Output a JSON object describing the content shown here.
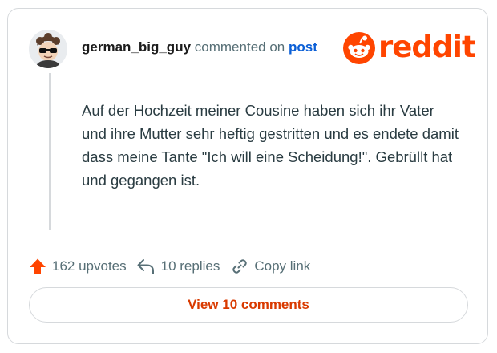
{
  "comment": {
    "username": "german_big_guy",
    "action_text": "commented on",
    "post_link": "post",
    "body": "Auf der Hochzeit meiner Cousine haben sich ihr Vater und ihre Mutter sehr heftig gestritten und es endete damit dass meine Tante \"Ich will eine Scheidung!\". Gebrüllt hat und gegangen ist."
  },
  "brand": {
    "logo_text": "reddit",
    "color": "#ff4500"
  },
  "actions": {
    "upvotes": "162 upvotes",
    "replies": "10 replies",
    "copy_link": "Copy link"
  },
  "footer": {
    "view_comments": "View 10 comments"
  },
  "icons": {
    "upvote": "upvote-arrow-icon",
    "reply": "reply-arrow-icon",
    "link": "link-chain-icon",
    "logo": "reddit-snoo-icon"
  },
  "colors": {
    "upvote_active": "#ff4500",
    "link_blue": "#0b5fd6",
    "button_text": "#d93a00"
  }
}
